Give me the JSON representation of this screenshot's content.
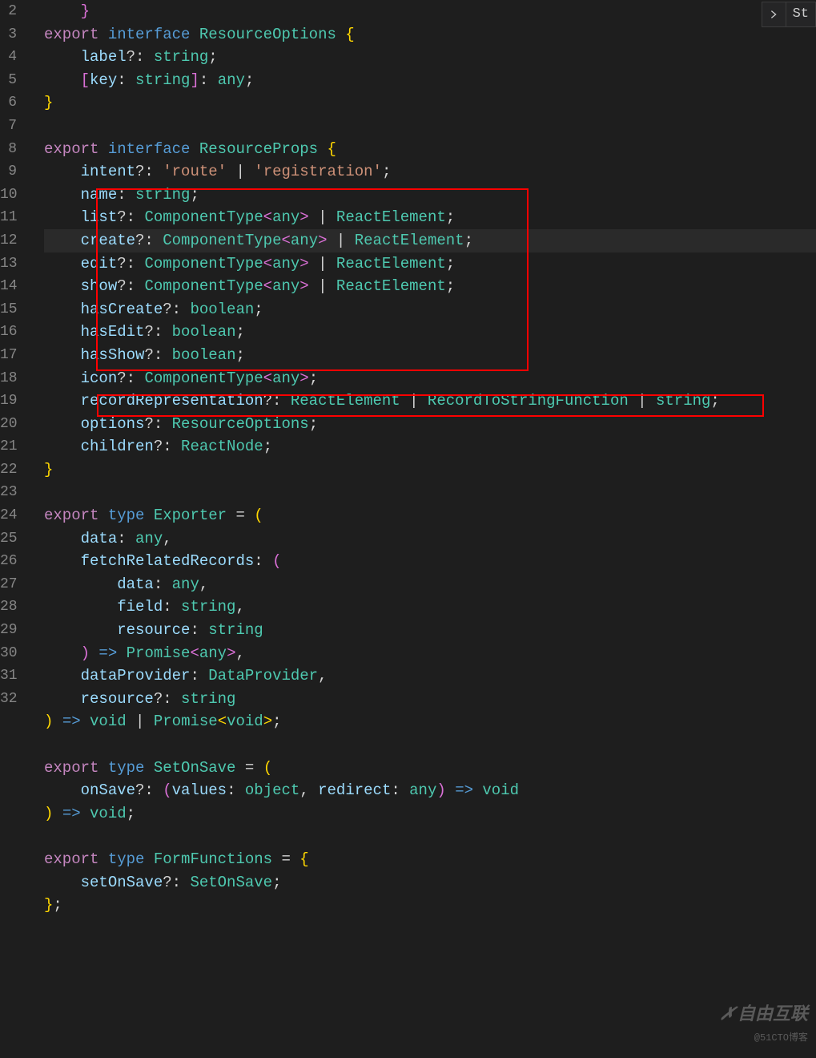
{
  "toolbar": {
    "label": "St"
  },
  "watermark": {
    "main": "自由互联",
    "sub": "@51CTO博客"
  },
  "gutter": {
    "start": 2,
    "end": 32
  },
  "code": {
    "l0": "}",
    "l1_export": "export",
    "l1_interface": "interface",
    "l1_name": "ResourceOptions",
    "l1_brace": "{",
    "l2_prop": "label",
    "l2_q": "?:",
    "l2_type": "string",
    "l2_semi": ";",
    "l3_open": "[",
    "l3_key": "key",
    "l3_colon": ":",
    "l3_string": "string",
    "l3_close": "]",
    "l3_colon2": ":",
    "l3_any": "any",
    "l3_semi": ";",
    "l4_brace": "}",
    "l6_export": "export",
    "l6_interface": "interface",
    "l6_name": "ResourceProps",
    "l6_brace": "{",
    "l7_prop": "intent",
    "l7_q": "?:",
    "l7_route": "'route'",
    "l7_pipe": "|",
    "l7_reg": "'registration'",
    "l7_semi": ";",
    "l8_prop": "name",
    "l8_colon": ":",
    "l8_string": "string",
    "l8_semi": ";",
    "l9_prop": "list",
    "l9_q": "?:",
    "l9_ct": "ComponentType",
    "l9_lt": "<",
    "l9_any": "any",
    "l9_gt": ">",
    "l9_pipe": "|",
    "l9_re": "ReactElement",
    "l9_semi": ";",
    "l10_prop": "create",
    "l10_q": "?:",
    "l10_ct": "ComponentType",
    "l10_lt": "<",
    "l10_any": "any",
    "l10_gt": ">",
    "l10_pipe": "|",
    "l10_re": "ReactElement",
    "l10_semi": ";",
    "l11_prop": "edit",
    "l11_q": "?:",
    "l11_ct": "ComponentType",
    "l11_lt": "<",
    "l11_any": "any",
    "l11_gt": ">",
    "l11_pipe": "|",
    "l11_re": "ReactElement",
    "l11_semi": ";",
    "l12_prop": "show",
    "l12_q": "?:",
    "l12_ct": "ComponentType",
    "l12_lt": "<",
    "l12_any": "any",
    "l12_gt": ">",
    "l12_pipe": "|",
    "l12_re": "ReactElement",
    "l12_semi": ";",
    "l13_prop": "hasCreate",
    "l13_q": "?:",
    "l13_bool": "boolean",
    "l13_semi": ";",
    "l14_prop": "hasEdit",
    "l14_q": "?:",
    "l14_bool": "boolean",
    "l14_semi": ";",
    "l15_prop": "hasShow",
    "l15_q": "?:",
    "l15_bool": "boolean",
    "l15_semi": ";",
    "l16_prop": "icon",
    "l16_q": "?:",
    "l16_ct": "ComponentType",
    "l16_lt": "<",
    "l16_any": "any",
    "l16_gt": ">",
    "l16_semi": ";",
    "l17_prop": "recordRepresentation",
    "l17_q": "?:",
    "l17_re": "ReactElement",
    "l17_pipe1": "|",
    "l17_rts": "RecordToStringFunction",
    "l17_pipe2": "|",
    "l17_string": "string",
    "l17_semi": ";",
    "l18_prop": "options",
    "l18_q": "?:",
    "l18_ro": "ResourceOptions",
    "l18_semi": ";",
    "l19_prop": "children",
    "l19_q": "?:",
    "l19_rn": "ReactNode",
    "l19_semi": ";",
    "l20_brace": "}",
    "l22_export": "export",
    "l22_type": "type",
    "l22_name": "Exporter",
    "l22_eq": "=",
    "l22_paren": "(",
    "l23_prop": "data",
    "l23_colon": ":",
    "l23_any": "any",
    "l23_comma": ",",
    "l24_prop": "fetchRelatedRecords",
    "l24_colon": ":",
    "l24_paren": "(",
    "l25_prop": "data",
    "l25_colon": ":",
    "l25_any": "any",
    "l25_comma": ",",
    "l26_prop": "field",
    "l26_colon": ":",
    "l26_string": "string",
    "l26_comma": ",",
    "l27_prop": "resource",
    "l27_colon": ":",
    "l27_string": "string",
    "l28_paren": ")",
    "l28_arrow": "=>",
    "l28_promise": "Promise",
    "l28_lt": "<",
    "l28_any": "any",
    "l28_gt": ">",
    "l28_comma": ",",
    "l29_prop": "dataProvider",
    "l29_colon": ":",
    "l29_dp": "DataProvider",
    "l29_comma": ",",
    "l30_prop": "resource",
    "l30_q": "?:",
    "l30_string": "string",
    "l31_paren": ")",
    "l31_arrow": "=>",
    "l31_void": "void",
    "l31_pipe": "|",
    "l31_promise": "Promise",
    "l31_lt": "<",
    "l31_void2": "void",
    "l31_gt": ">",
    "l31_semi": ";",
    "l33_export": "export",
    "l33_type": "type",
    "l33_name": "SetOnSave",
    "l33_eq": "=",
    "l33_paren": "(",
    "l34_prop": "onSave",
    "l34_q": "?:",
    "l34_paren1": "(",
    "l34_values": "values",
    "l34_colon1": ":",
    "l34_object": "object",
    "l34_comma": ",",
    "l34_redirect": "redirect",
    "l34_colon2": ":",
    "l34_any": "any",
    "l34_paren2": ")",
    "l34_arrow": "=>",
    "l34_void": "void",
    "l35_paren": ")",
    "l35_arrow": "=>",
    "l35_void": "void",
    "l35_semi": ";",
    "l37_export": "export",
    "l37_type": "type",
    "l37_name": "FormFunctions",
    "l37_eq": "=",
    "l37_brace": "{",
    "l38_prop": "setOnSave",
    "l38_q": "?:",
    "l38_sos": "SetOnSave",
    "l38_semi": ";",
    "l39_brace": "}",
    "l39_semi": ";"
  }
}
